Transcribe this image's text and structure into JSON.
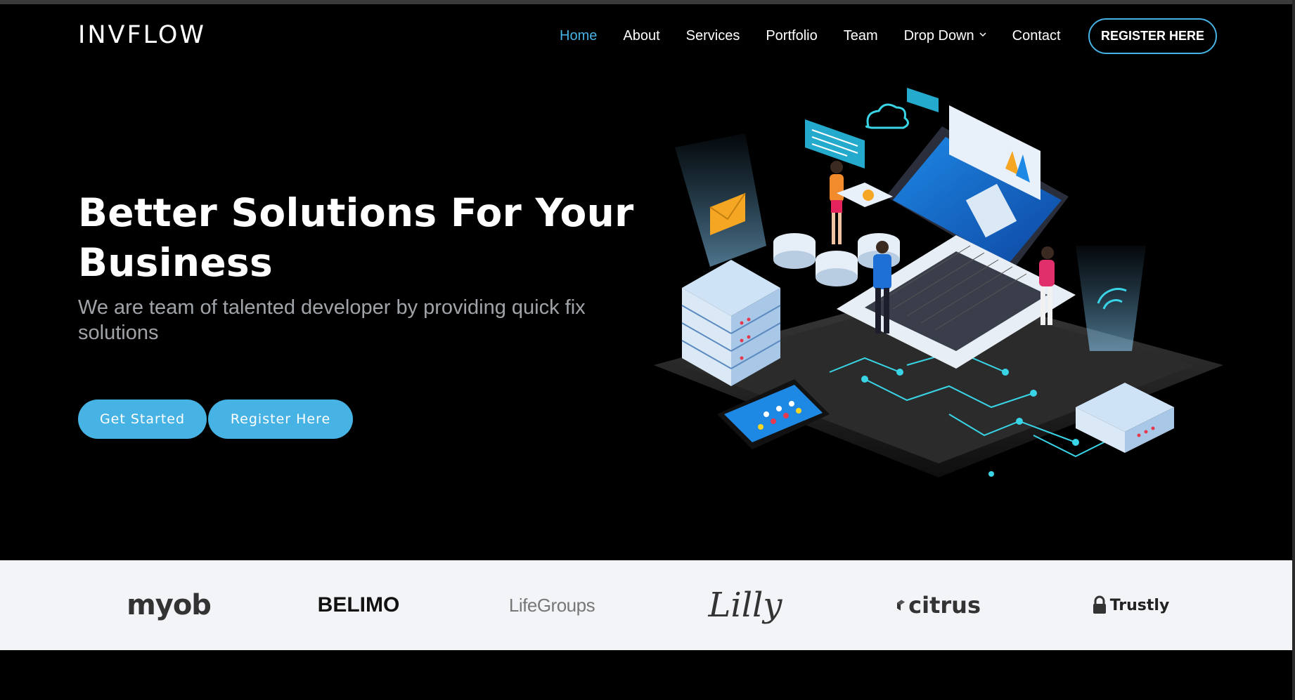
{
  "header": {
    "logo": "INVFLOW",
    "nav": [
      {
        "label": "Home",
        "active": true
      },
      {
        "label": "About",
        "active": false
      },
      {
        "label": "Services",
        "active": false
      },
      {
        "label": "Portfolio",
        "active": false
      },
      {
        "label": "Team",
        "active": false
      },
      {
        "label": "Drop Down",
        "active": false,
        "dropdown": true
      },
      {
        "label": "Contact",
        "active": false
      }
    ],
    "register_button": "REGISTER HERE"
  },
  "hero": {
    "title": "Better Solutions For Your Business",
    "subtitle": "We are team of talented developer by providing quick fix solutions",
    "get_started": "Get Started",
    "register_here": "Register Here",
    "illustration": "isometric-laptop-servers-illustration"
  },
  "clients": [
    {
      "name": "myob"
    },
    {
      "name": "BELIMO"
    },
    {
      "name": "LifeGroups"
    },
    {
      "name": "Lilly"
    },
    {
      "name": "citrus"
    },
    {
      "name": "Trustly"
    }
  ],
  "colors": {
    "accent": "#47b2e4",
    "background": "#000000",
    "clients_band": "#f3f4f8",
    "subtitle": "#a0a4a8"
  }
}
